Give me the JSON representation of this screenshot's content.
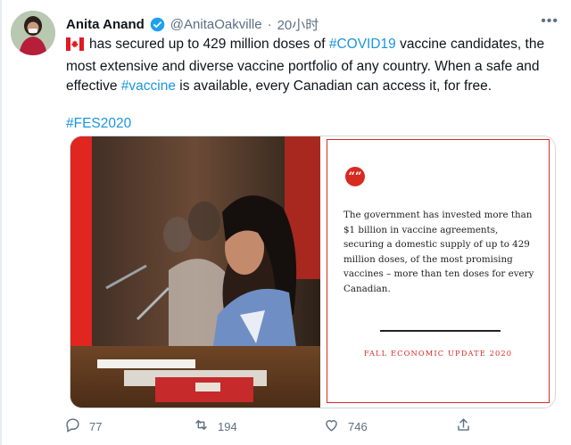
{
  "tweet": {
    "author_name": "Anita Anand",
    "handle": "@AnitaOakville",
    "separator": "·",
    "time": "20小时",
    "more": "•••",
    "text_parts": {
      "p1": "has secured up to 429 million doses of ",
      "hashtag_covid": "#COVID19",
      "p2": " vaccine candidates, the most extensive and diverse vaccine portfolio of any country. When a safe and effective ",
      "hashtag_vaccine": "#vaccine",
      "p3": " is available, every Canadian can access it, for free."
    },
    "hashtag_fes": "#FES2020"
  },
  "media_card": {
    "quote_mark": "““",
    "quote": "The government has invested more than $1 billion in vaccine agreements, securing a domestic supply of up to 429 million doses, of the most promising vaccines – more than ten doses for every Canadian.",
    "footer": "FALL ECONOMIC UPDATE 2020"
  },
  "actions": {
    "reply_count": "77",
    "retweet_count": "194",
    "like_count": "746"
  },
  "colors": {
    "link": "#1b95e0",
    "brand_red": "#d72b21",
    "muted": "#5b7083"
  }
}
